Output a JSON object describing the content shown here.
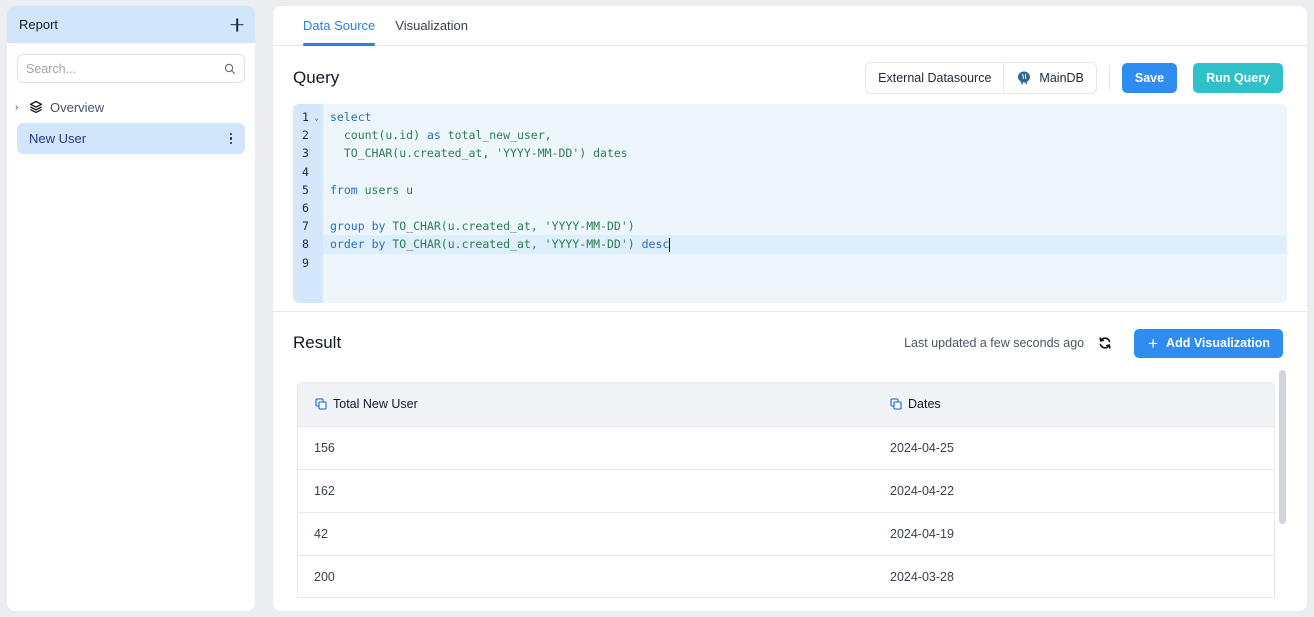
{
  "sidebar": {
    "title": "Report",
    "add_icon": "plus-icon",
    "search": {
      "placeholder": "Search...",
      "value": "",
      "icon": "search-icon"
    },
    "tree": [
      {
        "label": "Overview",
        "icon": "layers-icon",
        "expand_icon": "chevron-right-icon",
        "selected": false
      },
      {
        "label": "New User",
        "icon": "kebab-menu-icon",
        "selected": true
      }
    ]
  },
  "tabs": [
    {
      "label": "Data Source",
      "active": true
    },
    {
      "label": "Visualization",
      "active": false
    }
  ],
  "query": {
    "title": "Query",
    "datasource_type": "External Datasource",
    "datasource_name": "MainDB",
    "datasource_icon": "postgresql-elephant-icon",
    "save_label": "Save",
    "run_label": "Run Query",
    "accent_save": "#2f8cf0",
    "accent_run": "#2fc1c9",
    "line_numbers": [
      "1",
      "2",
      "3",
      "4",
      "5",
      "6",
      "7",
      "8",
      "9"
    ],
    "code_lines": [
      "select",
      "  count(u.id) as total_new_user,",
      "  TO_CHAR(u.created_at, 'YYYY-MM-DD') dates",
      "",
      "from users u",
      "",
      "group by TO_CHAR(u.created_at, 'YYYY-MM-DD')",
      "order by TO_CHAR(u.created_at, 'YYYY-MM-DD') desc",
      ""
    ],
    "active_line": 8
  },
  "result": {
    "title": "Result",
    "updated_text": "Last updated a few seconds ago",
    "refresh_icon": "refresh-icon",
    "add_viz_label": "Add Visualization",
    "columns": [
      "Total New User",
      "Dates"
    ],
    "rows": [
      [
        "156",
        "2024-04-25"
      ],
      [
        "162",
        "2024-04-22"
      ],
      [
        "42",
        "2024-04-19"
      ],
      [
        "200",
        "2024-03-28"
      ]
    ]
  }
}
